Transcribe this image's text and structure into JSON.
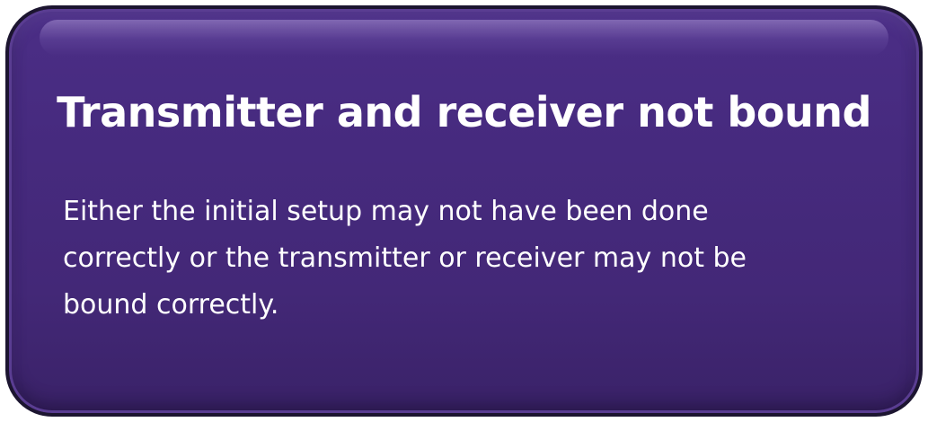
{
  "card": {
    "title": "Transmitter and receiver not bound",
    "message": "Either the initial setup may not have been done\ncorrectly or  the transmitter or receiver may not be\nbound correctly.",
    "background_color": "#462a7e",
    "text_color": "#ffffff"
  }
}
